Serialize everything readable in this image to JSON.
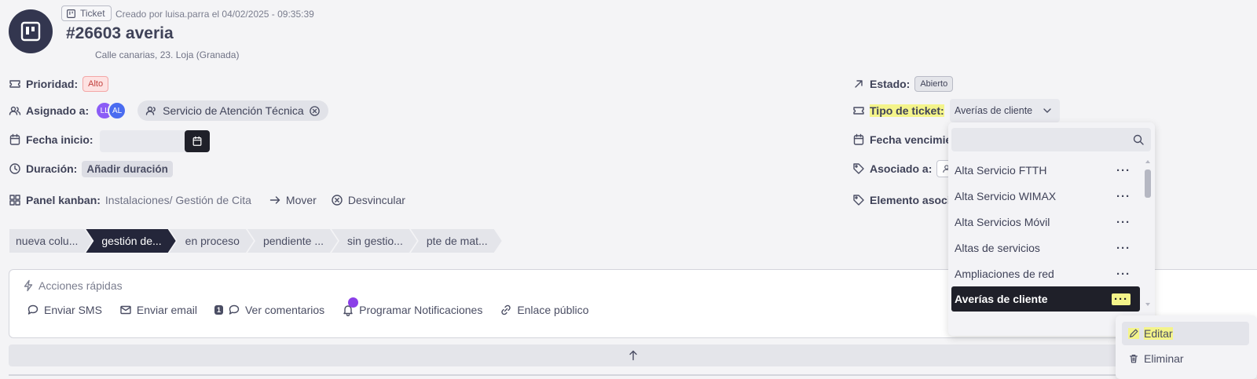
{
  "header": {
    "ticket_chip": "Ticket",
    "created": "Creado por luisa.parra el 04/02/2025 - 09:35:39",
    "title": "#26603 averia",
    "address": "Calle canarias, 23. Loja (Granada)"
  },
  "fields": {
    "prioridad_label": "Prioridad:",
    "prioridad_value": "Alto",
    "asignado_label": "Asignado a:",
    "avatars": [
      "LL",
      "AL"
    ],
    "service": "Servicio de Atención Técnica",
    "fecha_inicio_label": "Fecha inicio:",
    "duracion_label": "Duración:",
    "duracion_value": "Añadir duración",
    "kanban_label": "Panel kanban:",
    "kanban_value": "Instalaciones/ Gestión de Cita",
    "mover": "Mover",
    "desvincular": "Desvincular",
    "estado_label": "Estado:",
    "estado_value": "Abierto",
    "tipo_label": "Tipo de ticket:",
    "tipo_value": "Averías de cliente",
    "vencimiento_label": "Fecha vencimie",
    "asociado_label": "Asociado a:",
    "elemento_label": "Elemento asocia"
  },
  "kanban_stages": [
    "nueva colu...",
    "gestión de...",
    "en proceso",
    "pendiente ...",
    "sin gestio...",
    "pte de mat..."
  ],
  "quick_actions": {
    "title": "Acciones rápidas",
    "sms": "Enviar SMS",
    "email": "Enviar email",
    "comments_count": "1",
    "comments": "Ver comentarios",
    "notifications": "Programar Notificaciones",
    "public_link": "Enlace público"
  },
  "dropdown": {
    "items": [
      "Alta Servicio FTTH",
      "Alta Servicio WIMAX",
      "Alta Servicios Móvil",
      "Altas de servicios",
      "Ampliaciones de red",
      "Averías de cliente"
    ],
    "selected": "Averías de cliente"
  },
  "context_menu": {
    "edit": "Editar",
    "delete": "Eliminar"
  },
  "colors": {
    "dark": "#1f2029",
    "highlight": "#f4f48a",
    "notification_dot": "#8b3fe8",
    "priority_high": "#c2413e"
  }
}
